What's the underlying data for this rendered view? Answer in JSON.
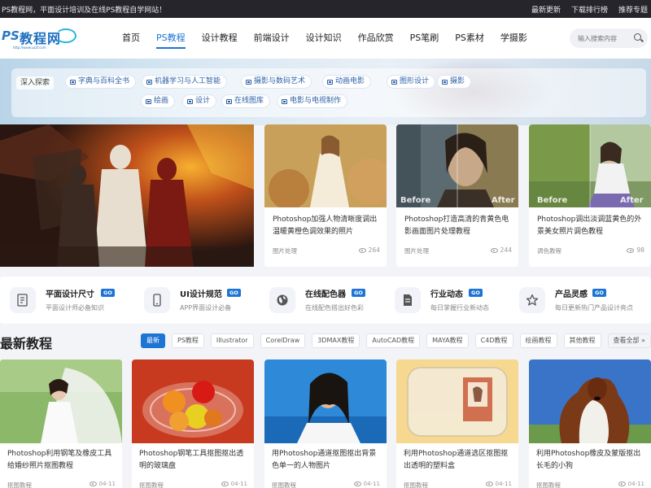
{
  "topbar": {
    "slogan": "PS教程网，平面设计培训及在线PS教程自学网站！",
    "links": [
      "最新更新",
      "下载排行榜",
      "推荐专题"
    ]
  },
  "header": {
    "logo_ps": "PS",
    "logo_text": "教程网",
    "logo_url": "http://www.uzzf.com",
    "nav": [
      "首页",
      "PS教程",
      "设计教程",
      "前端设计",
      "设计知识",
      "作品欣赏",
      "PS笔刷",
      "PS素材",
      "学摄影"
    ],
    "nav_active": "PS教程",
    "search_placeholder": "输入搜索内容"
  },
  "explore": {
    "title": "深入探索",
    "tags": [
      "字典与百科全书",
      "机器学习与人工智能",
      "摄影与数码艺术",
      "动画电影",
      "图形设计",
      "摄影",
      "绘画",
      "设计",
      "在线图库",
      "电影与电视制作"
    ]
  },
  "featured": [
    {
      "title": "Photoshop加强人物清晰度调出温暖黄橙色调效果的照片",
      "category": "图片处理",
      "views": "264"
    },
    {
      "title": "Photoshop打造高清的青黄色电影画面图片处理教程",
      "category": "图片处理",
      "views": "244",
      "before": "Before",
      "after": "After"
    },
    {
      "title": "Photoshop调出淡调蓝黄色的外景美女照片调色教程",
      "category": "调色教程",
      "views": "98",
      "before": "Before",
      "after": "After"
    }
  ],
  "features": [
    {
      "title": "平面设计尺寸",
      "badge": "GO",
      "sub": "平面设计师必备知识",
      "icon": "ruler-doc-icon"
    },
    {
      "title": "UI设计规范",
      "badge": "GO",
      "sub": "APP界面设计必备",
      "icon": "phone-icon"
    },
    {
      "title": "在线配色器",
      "badge": "GO",
      "sub": "在线配色搭出好色彩",
      "icon": "globe-icon"
    },
    {
      "title": "行业动态",
      "badge": "GO",
      "sub": "每日掌握行业新动态",
      "icon": "document-icon"
    },
    {
      "title": "产品灵感",
      "badge": "GO",
      "sub": "每日更新热门产品设计亮点",
      "icon": "star-icon"
    }
  ],
  "latest": {
    "title": "最新教程",
    "filters": [
      "最新",
      "PS教程",
      "Illustrator",
      "CorelDraw",
      "3DMAX教程",
      "AutoCAD教程",
      "MAYA教程",
      "C4D教程",
      "绘画教程",
      "其他教程",
      "查看全部 »"
    ],
    "active_filter": "最新",
    "items": [
      {
        "title": "Photoshop利用钢笔及橡皮工具给婚纱照片抠图教程",
        "category": "抠图教程",
        "date": "04-11"
      },
      {
        "title": "Photoshop钢笔工具抠图抠出透明的玻璃盘",
        "category": "抠图教程",
        "date": "04-11"
      },
      {
        "title": "用Photoshop通道抠图抠出背景色单一的人物图片",
        "category": "抠图教程",
        "date": "04-11"
      },
      {
        "title": "利用Photoshop通道选区抠图抠出透明的塑料盒",
        "category": "抠图教程",
        "date": "04-11"
      },
      {
        "title": "利用Photoshop橡皮及蒙版抠出长毛的小狗",
        "category": "抠图教程",
        "date": "04-11"
      }
    ]
  },
  "colors": {
    "accent": "#1c74d4",
    "topbar_bg": "#25252b",
    "page_bg": "#f3f4f8"
  }
}
